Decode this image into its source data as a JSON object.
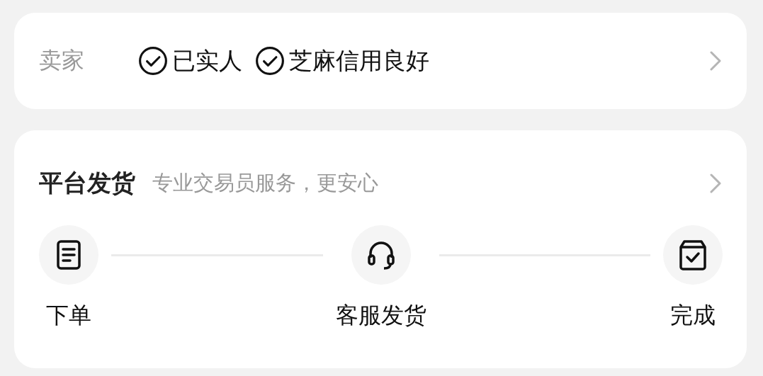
{
  "seller": {
    "label": "卖家",
    "badges": [
      "已实人",
      "芝麻信用良好"
    ]
  },
  "shipping": {
    "title": "平台发货",
    "subtitle": "专业交易员服务，更安心",
    "steps": [
      {
        "label": "下单"
      },
      {
        "label": "客服发货"
      },
      {
        "label": "完成"
      }
    ]
  }
}
